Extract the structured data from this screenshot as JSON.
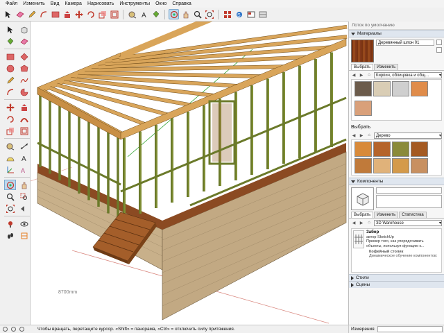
{
  "menu": [
    "Файл",
    "Изменить",
    "Вид",
    "Камера",
    "Нарисовать",
    "Инструменты",
    "Окно",
    "Справка"
  ],
  "toolbar_icons": [
    "select-arrow-icon",
    "eraser-icon",
    "pencil-icon",
    "arc-icon",
    "rectangle-icon",
    "pushpull-icon",
    "move-icon",
    "rotate-icon",
    "scale-icon",
    "offset-icon",
    "tape-measure-icon",
    "text-icon",
    "paint-bucket-icon",
    "orbit-icon",
    "pan-icon",
    "zoom-icon",
    "zoom-extents-icon",
    "warehouse-icon",
    "extension-icon",
    "layout-icon",
    "sandbox-icon"
  ],
  "viewport": {
    "dimension_label": "8700mm",
    "colors": {
      "sky": "#ffffff",
      "ground": "#ffffff",
      "brick": "#b8a07a",
      "wood": "#d9a55a",
      "frame": "#6b7a2a",
      "green_axis": "#2ca02c",
      "red_axis": "#c0392b"
    }
  },
  "tray": {
    "title": "Лоток по умолчанию",
    "materials": {
      "header": "Материалы",
      "name": "Деревянный шпон 01",
      "tabs": [
        "Выбрать",
        "Изменить"
      ],
      "library1": "Кирпич, облицовка и общ...",
      "library2": "Дерево",
      "select_label": "Выбрать",
      "swatches1": [
        "#6b5b4b",
        "#d9cdb5",
        "#cfcfcf",
        "#e08c4a",
        "#d9a07a"
      ],
      "swatches2": [
        "#d88a3a",
        "#b5642a",
        "#8a8a3a",
        "#a45a22",
        "#c07a3a",
        "#e0b27a",
        "#d49a4a",
        "#c89060"
      ]
    },
    "components": {
      "header": "Компоненты",
      "tabs": [
        "Выбрать",
        "Изменить",
        "Статистика"
      ],
      "library": "3D Warehouse",
      "item1_title": "Забор",
      "item1_author": "автор SketchUp",
      "item1_desc": "Пример того, как упорядочивать объекты, используя функцию к...",
      "item2_title": "Кофейный столик",
      "item2_desc": "Динамическое обучение компонентов:"
    },
    "footer": [
      "Стили",
      "Сцены"
    ]
  },
  "status": {
    "hint": "Чтобы вращать, перетащите курсор. «Shift» = панорама, «Ctrl» = отключить силу притяжения.",
    "measure_label": "Измерения"
  }
}
